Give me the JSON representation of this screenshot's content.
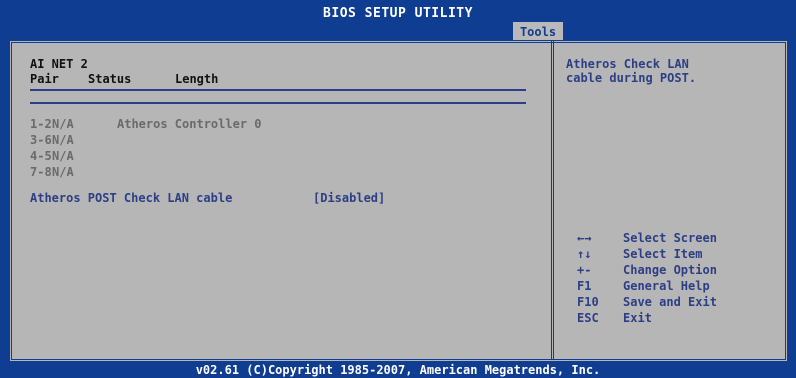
{
  "header": {
    "title": "BIOS SETUP UTILITY",
    "active_tab": "Tools"
  },
  "main": {
    "section_title": "AI NET 2",
    "columns": [
      "Pair",
      "Status",
      "Length"
    ],
    "pairs": [
      {
        "pair": "1-2",
        "status": "N/A",
        "extra": "Atheros Controller 0"
      },
      {
        "pair": "3-6",
        "status": "N/A",
        "extra": ""
      },
      {
        "pair": "4-5",
        "status": "N/A",
        "extra": ""
      },
      {
        "pair": "7-8",
        "status": "N/A",
        "extra": ""
      }
    ],
    "setting": {
      "label": "Atheros POST Check LAN cable",
      "value": "[Disabled]"
    }
  },
  "help": {
    "text_line1": "Atheros Check LAN",
    "text_line2": "cable during POST.",
    "keys": [
      {
        "key": "←→",
        "desc": "Select Screen"
      },
      {
        "key": "↑↓",
        "desc": "Select Item"
      },
      {
        "key": "+-",
        "desc": "Change Option"
      },
      {
        "key": "F1",
        "desc": "General Help"
      },
      {
        "key": "F10",
        "desc": "Save and Exit"
      },
      {
        "key": "ESC",
        "desc": "Exit"
      }
    ]
  },
  "footer": {
    "text": "v02.61 (C)Copyright 1985-2007, American Megatrends, Inc."
  }
}
